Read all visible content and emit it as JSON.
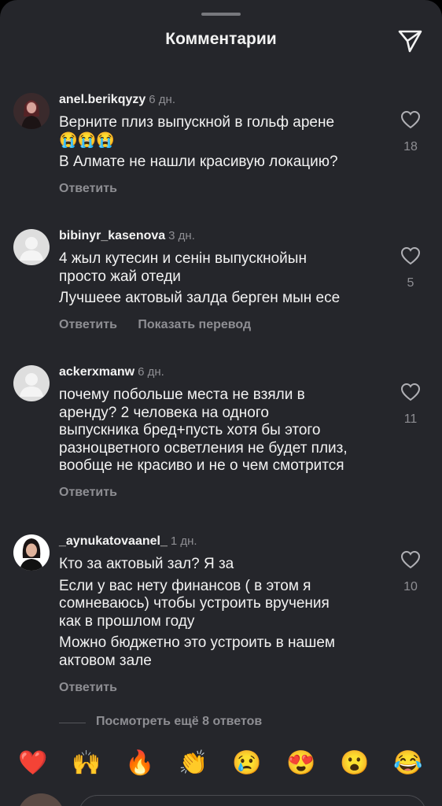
{
  "header": {
    "title": "Комментарии",
    "share_icon": "paper-plane-icon"
  },
  "comments": [
    {
      "username": "anel.berikqyzy",
      "time": "6 дн.",
      "avatar": "photo",
      "lines": [
        "Верните плиз выпускной в гольф арене\n😭😭😭",
        "В Алмате не нашли красивую локацию?"
      ],
      "likes": "18",
      "reply_label": "Ответить"
    },
    {
      "username": "bibinyr_kasenova",
      "time": "3 дн.",
      "avatar": "default",
      "lines": [
        "4 жыл кутесин и сенін выпускнойын\nпросто жай отеди",
        "Лучшеее актовый залда берген мын есе"
      ],
      "likes": "5",
      "reply_label": "Ответить",
      "translate_label": "Показать перевод"
    },
    {
      "username": "ackerxmanw",
      "time": "6 дн.",
      "avatar": "default",
      "lines": [
        "почему побольше места не взяли в\nаренду? 2 человека на одного\nвыпускника бред+пусть хотя бы этого\nразноцветного осветления не будет плиз,\nвообще не красиво и не о чем смотрится"
      ],
      "likes": "11",
      "reply_label": "Ответить"
    },
    {
      "username": "_aynukatovaanel_",
      "time": "1 дн.",
      "avatar": "photo",
      "lines": [
        "Кто за актовый зал? Я за",
        "Если у вас нету финансов ( в этом я\nсомневаюсь) чтобы устроить вручения\nкак в прошлом году",
        "Можно бюджетно это устроить в нашем\nактовом зале"
      ],
      "likes": "10",
      "reply_label": "Ответить"
    }
  ],
  "view_more": "Посмотреть ещё 8 ответов",
  "reactions": [
    "❤️",
    "🙌",
    "🔥",
    "👏",
    "😢",
    "😍",
    "😮",
    "😂"
  ],
  "colors": {
    "sheet_bg": "#25262b",
    "text": "#f2f2f2",
    "muted": "#8e8e93"
  }
}
